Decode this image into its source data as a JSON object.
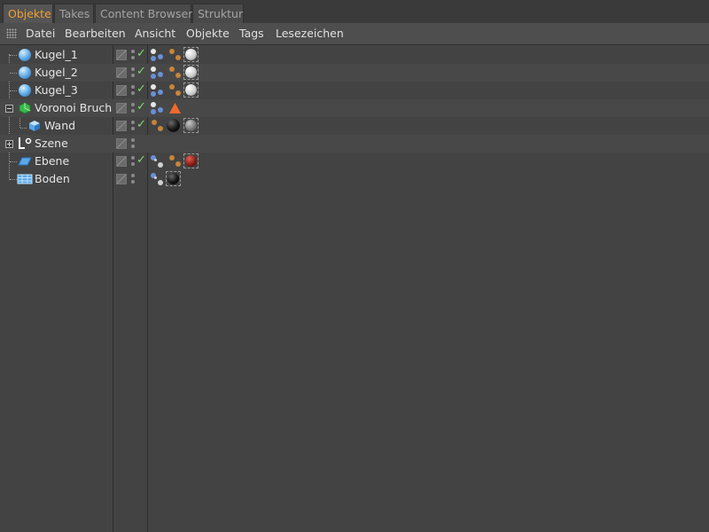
{
  "tabs": [
    {
      "label": "Objekte",
      "active": true
    },
    {
      "label": "Takes",
      "active": false
    },
    {
      "label": "Content Browser",
      "active": false
    },
    {
      "label": "Struktur",
      "active": false
    }
  ],
  "menu": [
    "Datei",
    "Bearbeiten",
    "Ansicht",
    "Objekte",
    "Tags",
    "Lesezeichen"
  ],
  "objects": [
    {
      "name": "Kugel_1",
      "icon": "sphere-icon",
      "enabled": true,
      "tags": [
        "particle-tag-icon",
        "dynamics-tag-icon",
        "material-tag-white-icon"
      ]
    },
    {
      "name": "Kugel_2",
      "icon": "sphere-icon",
      "enabled": true,
      "tags": [
        "particle-tag-icon",
        "dynamics-tag-icon",
        "material-tag-white-icon"
      ]
    },
    {
      "name": "Kugel_3",
      "icon": "sphere-icon",
      "enabled": true,
      "tags": [
        "particle-tag-icon",
        "dynamics-tag-icon",
        "material-tag-white-icon"
      ]
    },
    {
      "name": "Voronoi Bruch",
      "icon": "voronoi-fracture-icon",
      "enabled": true,
      "tags": [
        "particle-tag-icon",
        "warning-tag-icon"
      ]
    },
    {
      "name": "Wand",
      "icon": "cube-icon",
      "enabled": true,
      "tags": [
        "dynamics-tag-icon",
        "material-tag-black-icon",
        "material-tag-grey-icon"
      ]
    },
    {
      "name": "Szene",
      "icon": "null-object-icon",
      "enabled": false,
      "tags": []
    },
    {
      "name": "Ebene",
      "icon": "plane-icon",
      "enabled": true,
      "tags": [
        "collider-tag-icon",
        "dynamics-tag-icon",
        "material-tag-red-icon"
      ]
    },
    {
      "name": "Boden",
      "icon": "floor-icon",
      "enabled": false,
      "tags": [
        "collider-tag-icon",
        "material-tag-black-icon"
      ]
    }
  ],
  "colors": {
    "active_tab_text": "#f0a030",
    "check_mark": "#7fdc6f",
    "sphere_blue": "#5aa8e8",
    "voronoi_green": "#3bb84a",
    "warning_orange": "#f26a2a"
  }
}
